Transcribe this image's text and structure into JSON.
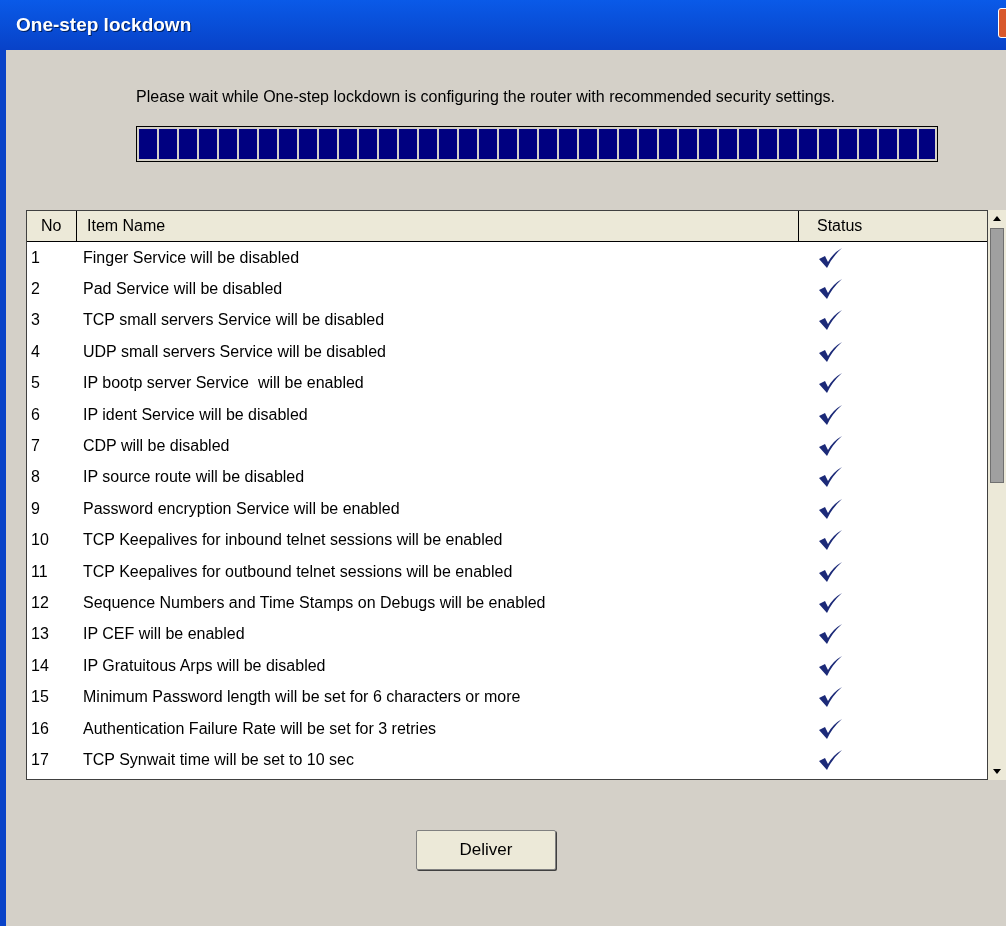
{
  "window": {
    "title": "One-step lockdown"
  },
  "message": "Please wait while One-step lockdown is configuring the router with recommended security settings.",
  "progress": {
    "level": 1
  },
  "table": {
    "columns": [
      "No",
      "Item Name",
      "Status"
    ],
    "rows": [
      {
        "no": "1",
        "name": "Finger Service will be disabled",
        "checked": true
      },
      {
        "no": "2",
        "name": "Pad Service will be disabled",
        "checked": true
      },
      {
        "no": "3",
        "name": "TCP small servers Service will be disabled",
        "checked": true
      },
      {
        "no": "4",
        "name": "UDP small servers Service will be disabled",
        "checked": true
      },
      {
        "no": "5",
        "name": "IP bootp server Service  will be enabled",
        "checked": true
      },
      {
        "no": "6",
        "name": "IP ident Service will be disabled",
        "checked": true
      },
      {
        "no": "7",
        "name": "CDP will be disabled",
        "checked": true
      },
      {
        "no": "8",
        "name": "IP source route will be disabled",
        "checked": true
      },
      {
        "no": "9",
        "name": "Password encryption Service will be enabled",
        "checked": true
      },
      {
        "no": "10",
        "name": "TCP Keepalives for inbound telnet sessions will be enabled",
        "checked": true
      },
      {
        "no": "11",
        "name": "TCP Keepalives for outbound telnet sessions will be enabled",
        "checked": true
      },
      {
        "no": "12",
        "name": "Sequence Numbers and Time Stamps on Debugs will be enabled",
        "checked": true
      },
      {
        "no": "13",
        "name": "IP CEF will be enabled",
        "checked": true
      },
      {
        "no": "14",
        "name": "IP Gratuitous Arps will be disabled",
        "checked": true
      },
      {
        "no": "15",
        "name": "Minimum Password length will be set for 6 characters or more",
        "checked": true
      },
      {
        "no": "16",
        "name": "Authentication Failure Rate will be set for 3 retries",
        "checked": true
      },
      {
        "no": "17",
        "name": "TCP Synwait time will be set to 10 sec",
        "checked": true
      }
    ]
  },
  "buttons": [
    "Deliver"
  ]
}
